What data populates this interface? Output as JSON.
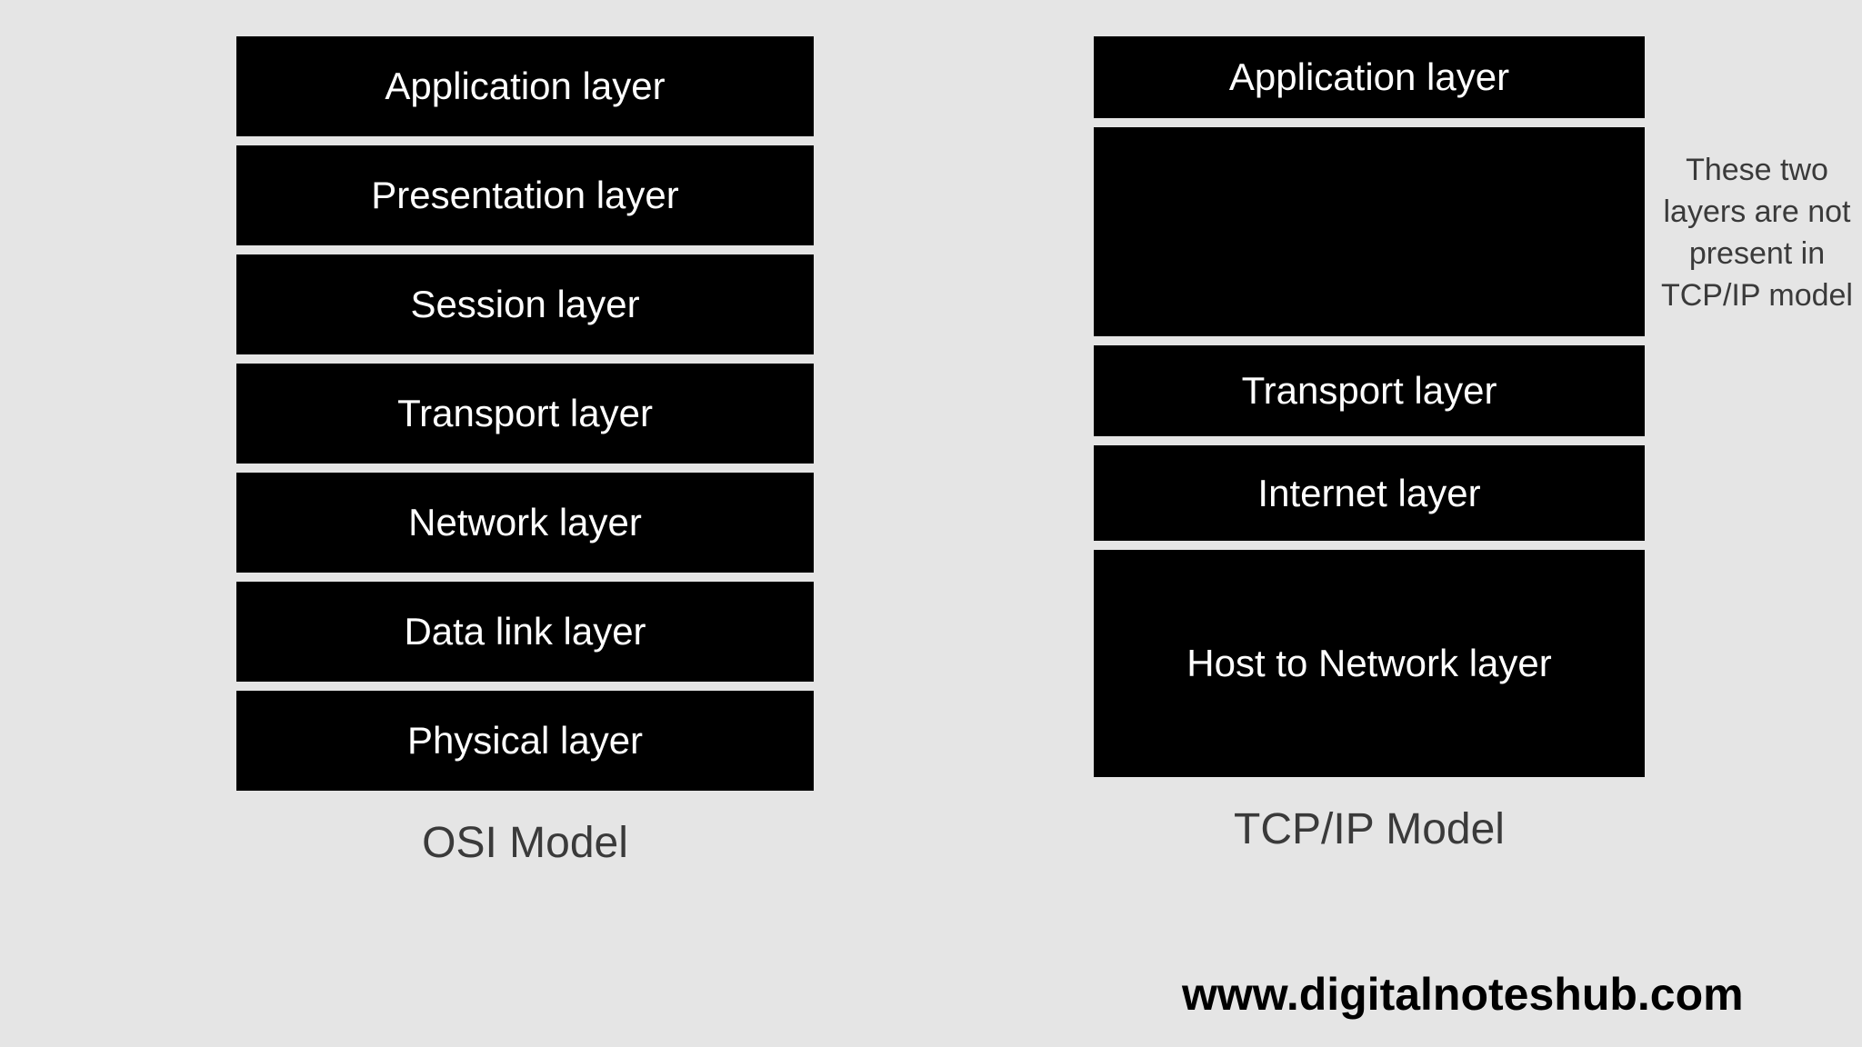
{
  "osi": {
    "title": "OSI Model",
    "layers": [
      "Application layer",
      "Presentation layer",
      "Session layer",
      "Transport layer",
      "Network layer",
      "Data link layer",
      "Physical layer"
    ]
  },
  "tcpip": {
    "title": "TCP/IP Model",
    "layers": {
      "application": "Application layer",
      "transport": "Transport layer",
      "internet": "Internet layer",
      "host": "Host to Network layer"
    }
  },
  "annotation": "These two layers are not present in TCP/IP model",
  "watermark": "www.digitalnoteshub.com"
}
